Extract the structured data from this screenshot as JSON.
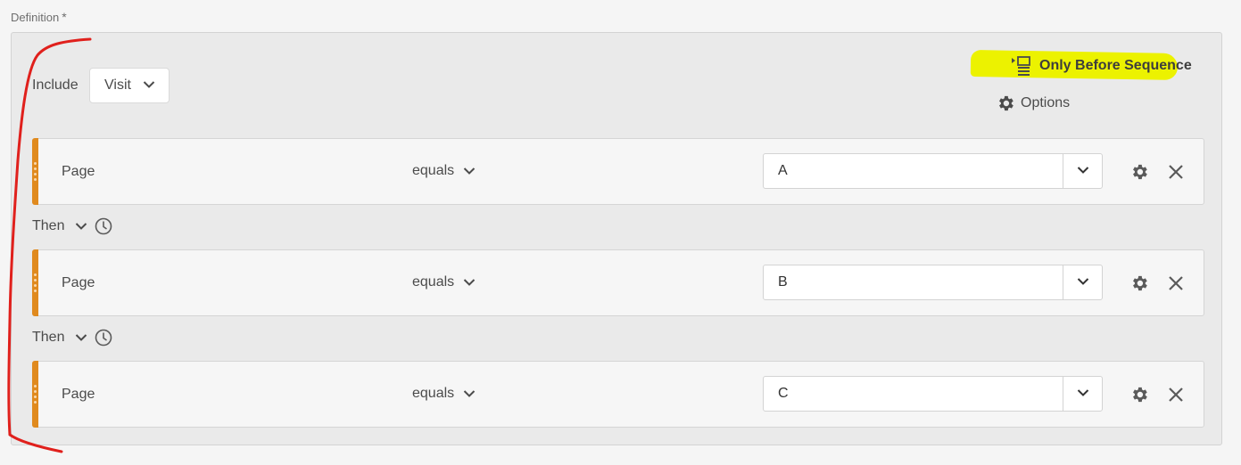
{
  "definition": {
    "label": "Definition",
    "required_mark": "*"
  },
  "container": {
    "include_label": "Include",
    "scope": "Visit",
    "sequence_button": {
      "label": "Only Before Sequence",
      "icon": "sequence-icon"
    },
    "options_button": {
      "label": "Options",
      "icon": "gear-icon"
    }
  },
  "rules": [
    {
      "dimension": "Page",
      "operator": "equals",
      "value": "A"
    },
    {
      "dimension": "Page",
      "operator": "equals",
      "value": "B"
    },
    {
      "dimension": "Page",
      "operator": "equals",
      "value": "C"
    }
  ],
  "then_connectors": [
    {
      "label": "Then",
      "icon": "clock-icon"
    },
    {
      "label": "Then",
      "icon": "clock-icon"
    }
  ],
  "colors": {
    "rule_accent": "#e08a1e",
    "highlight": "#ecf200",
    "annotation": "#e0201c"
  }
}
